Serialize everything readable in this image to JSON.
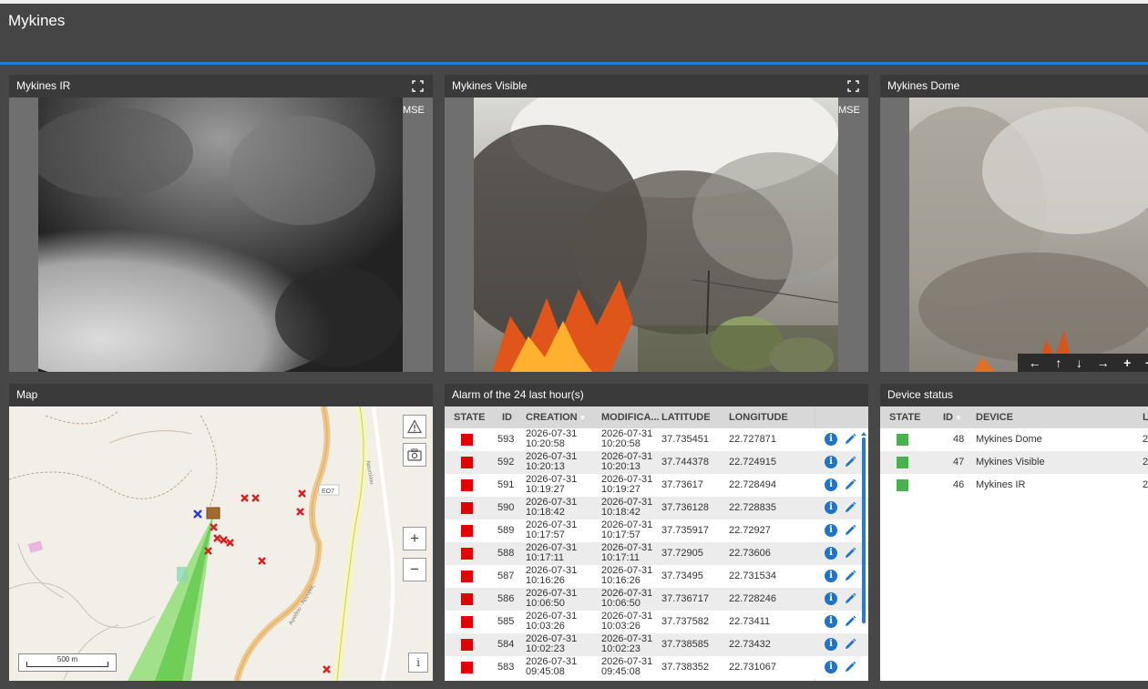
{
  "app": {
    "title": "Mykines"
  },
  "cameras": [
    {
      "title": "Mykines IR",
      "overlay": "MSE"
    },
    {
      "title": "Mykines Visible",
      "overlay": "MSE"
    },
    {
      "title": "Mykines Dome"
    }
  ],
  "ptz": {
    "controls": [
      "←",
      "↑",
      "↓",
      "→",
      "+",
      "−"
    ]
  },
  "map": {
    "title": "Map",
    "scale_label": "500 m",
    "road_label": "ΕΟ7",
    "street_label_1": "Αγιόδου - Αργυρός",
    "street_label_2": "Ναυπλίου",
    "zoom_in": "+",
    "zoom_out": "−",
    "info": "i"
  },
  "alarms": {
    "title": "Alarm of the 24 last hour(s)",
    "columns": {
      "state": "STATE",
      "id": "ID",
      "creation": "CREATION",
      "modified": "MODIFICA...",
      "latitude": "LATITUDE",
      "longitude": "LONGITUDE"
    },
    "state_color": "#e00000",
    "rows": [
      {
        "id": "593",
        "c_date": "2026-07-31",
        "c_time": "10:20:58",
        "m_date": "2026-07-31",
        "m_time": "10:20:58",
        "lat": "37.735451",
        "lon": "22.727871"
      },
      {
        "id": "592",
        "c_date": "2026-07-31",
        "c_time": "10:20:13",
        "m_date": "2026-07-31",
        "m_time": "10:20:13",
        "lat": "37.744378",
        "lon": "22.724915"
      },
      {
        "id": "591",
        "c_date": "2026-07-31",
        "c_time": "10:19:27",
        "m_date": "2026-07-31",
        "m_time": "10:19:27",
        "lat": "37.73617",
        "lon": "22.728494"
      },
      {
        "id": "590",
        "c_date": "2026-07-31",
        "c_time": "10:18:42",
        "m_date": "2026-07-31",
        "m_time": "10:18:42",
        "lat": "37.736128",
        "lon": "22.728835"
      },
      {
        "id": "589",
        "c_date": "2026-07-31",
        "c_time": "10:17:57",
        "m_date": "2026-07-31",
        "m_time": "10:17:57",
        "lat": "37.735917",
        "lon": "22.72927"
      },
      {
        "id": "588",
        "c_date": "2026-07-31",
        "c_time": "10:17:11",
        "m_date": "2026-07-31",
        "m_time": "10:17:11",
        "lat": "37.72905",
        "lon": "22.73606"
      },
      {
        "id": "587",
        "c_date": "2026-07-31",
        "c_time": "10:16:26",
        "m_date": "2026-07-31",
        "m_time": "10:16:26",
        "lat": "37.73495",
        "lon": "22.731534"
      },
      {
        "id": "586",
        "c_date": "2026-07-31",
        "c_time": "10:06:50",
        "m_date": "2026-07-31",
        "m_time": "10:06:50",
        "lat": "37.736717",
        "lon": "22.728246"
      },
      {
        "id": "585",
        "c_date": "2026-07-31",
        "c_time": "10:03:26",
        "m_date": "2026-07-31",
        "m_time": "10:03:26",
        "lat": "37.737582",
        "lon": "22.73411"
      },
      {
        "id": "584",
        "c_date": "2026-07-31",
        "c_time": "10:02:23",
        "m_date": "2026-07-31",
        "m_time": "10:02:23",
        "lat": "37.738585",
        "lon": "22.73432"
      },
      {
        "id": "583",
        "c_date": "2026-07-31",
        "c_time": "09:45:08",
        "m_date": "2026-07-31",
        "m_time": "09:45:08",
        "lat": "37.738352",
        "lon": "22.731067"
      }
    ]
  },
  "devices": {
    "title": "Device status",
    "columns": {
      "state": "STATE",
      "id": "ID",
      "device": "DEVICE",
      "extra": "L"
    },
    "state_color": "#4caf50",
    "rows": [
      {
        "id": "48",
        "name": "Mykines Dome",
        "extra": "2"
      },
      {
        "id": "47",
        "name": "Mykines Visible",
        "extra": "2"
      },
      {
        "id": "46",
        "name": "Mykines IR",
        "extra": "2"
      }
    ]
  }
}
